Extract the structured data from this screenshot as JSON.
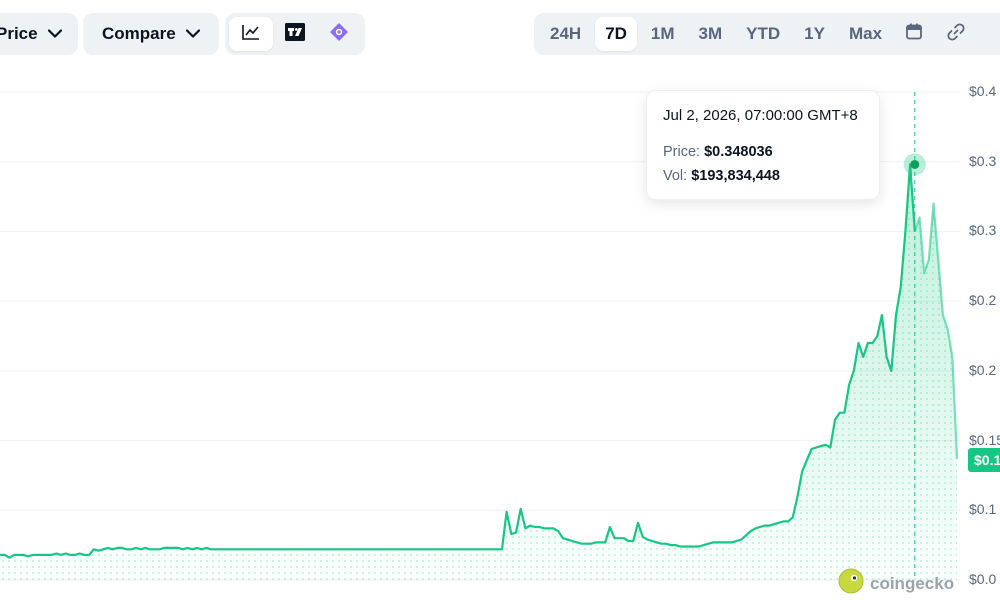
{
  "toolbar": {
    "price_dropdown": "Price",
    "compare_dropdown": "Compare",
    "view_icons": [
      "line-chart-icon",
      "tradingview-icon",
      "diamond-icon"
    ],
    "ranges": [
      "24H",
      "7D",
      "1M",
      "3M",
      "YTD",
      "1Y",
      "Max"
    ],
    "active_range": "7D",
    "extra_icons": [
      "calendar-icon",
      "link-icon"
    ]
  },
  "tooltip": {
    "date": "Jul 2, 2026, 07:00:00 GMT+8",
    "price_label": "Price:",
    "price_value": "$0.348036",
    "vol_label": "Vol:",
    "vol_value": "$193,834,448"
  },
  "current_price_tag": "$0.1",
  "watermark": "coingecko",
  "colors": {
    "line": "#16c784",
    "accent": "#16c784",
    "grid": "#eef0f3"
  },
  "chart_data": {
    "type": "area",
    "y_tick_labels": [
      "$0.4",
      "$0.3",
      "$0.3",
      "$0.2",
      "$0.2",
      "$0.15",
      "$0.1",
      "$0.0"
    ],
    "y_ticks": [
      0.4,
      0.35,
      0.3,
      0.25,
      0.2,
      0.15,
      0.1,
      0.05
    ],
    "ylim": [
      0.05,
      0.4
    ],
    "grid": true,
    "highlight": {
      "index": 195,
      "value": 0.348036
    },
    "last_value": 0.137,
    "series": [
      {
        "values": [
          0.068,
          0.068,
          0.066,
          0.068,
          0.068,
          0.068,
          0.067,
          0.068,
          0.068,
          0.068,
          0.068,
          0.068,
          0.069,
          0.068,
          0.069,
          0.068,
          0.068,
          0.069,
          0.068,
          0.068,
          0.072,
          0.071,
          0.072,
          0.073,
          0.072,
          0.073,
          0.073,
          0.072,
          0.072,
          0.073,
          0.072,
          0.073,
          0.072,
          0.072,
          0.072,
          0.073,
          0.073,
          0.073,
          0.073,
          0.072,
          0.073,
          0.072,
          0.073,
          0.072,
          0.073,
          0.072,
          0.072,
          0.072,
          0.072,
          0.072,
          0.072,
          0.072,
          0.072,
          0.072,
          0.072,
          0.072,
          0.072,
          0.072,
          0.072,
          0.072,
          0.072,
          0.072,
          0.072,
          0.072,
          0.072,
          0.072,
          0.072,
          0.072,
          0.072,
          0.072,
          0.072,
          0.072,
          0.072,
          0.072,
          0.072,
          0.072,
          0.072,
          0.072,
          0.072,
          0.072,
          0.072,
          0.072,
          0.072,
          0.072,
          0.072,
          0.072,
          0.072,
          0.072,
          0.072,
          0.072,
          0.072,
          0.072,
          0.072,
          0.072,
          0.072,
          0.072,
          0.072,
          0.072,
          0.072,
          0.072,
          0.072,
          0.072,
          0.072,
          0.072,
          0.072,
          0.072,
          0.072,
          0.072,
          0.099,
          0.083,
          0.084,
          0.101,
          0.087,
          0.089,
          0.088,
          0.088,
          0.087,
          0.087,
          0.087,
          0.085,
          0.08,
          0.079,
          0.078,
          0.077,
          0.076,
          0.076,
          0.076,
          0.077,
          0.077,
          0.077,
          0.088,
          0.08,
          0.08,
          0.08,
          0.078,
          0.078,
          0.091,
          0.081,
          0.079,
          0.078,
          0.077,
          0.076,
          0.076,
          0.075,
          0.075,
          0.074,
          0.074,
          0.074,
          0.074,
          0.074,
          0.075,
          0.076,
          0.077,
          0.077,
          0.077,
          0.077,
          0.077,
          0.078,
          0.079,
          0.082,
          0.085,
          0.087,
          0.088,
          0.089,
          0.089,
          0.09,
          0.091,
          0.092,
          0.092,
          0.095,
          0.11,
          0.128,
          0.136,
          0.144,
          0.145,
          0.146,
          0.147,
          0.145,
          0.165,
          0.17,
          0.17,
          0.19,
          0.2,
          0.22,
          0.21,
          0.22,
          0.22,
          0.225,
          0.24,
          0.21,
          0.2,
          0.24,
          0.26,
          0.3,
          0.348,
          0.3,
          0.31,
          0.27,
          0.28,
          0.32,
          0.28,
          0.24,
          0.23,
          0.21,
          0.137
        ]
      }
    ]
  }
}
